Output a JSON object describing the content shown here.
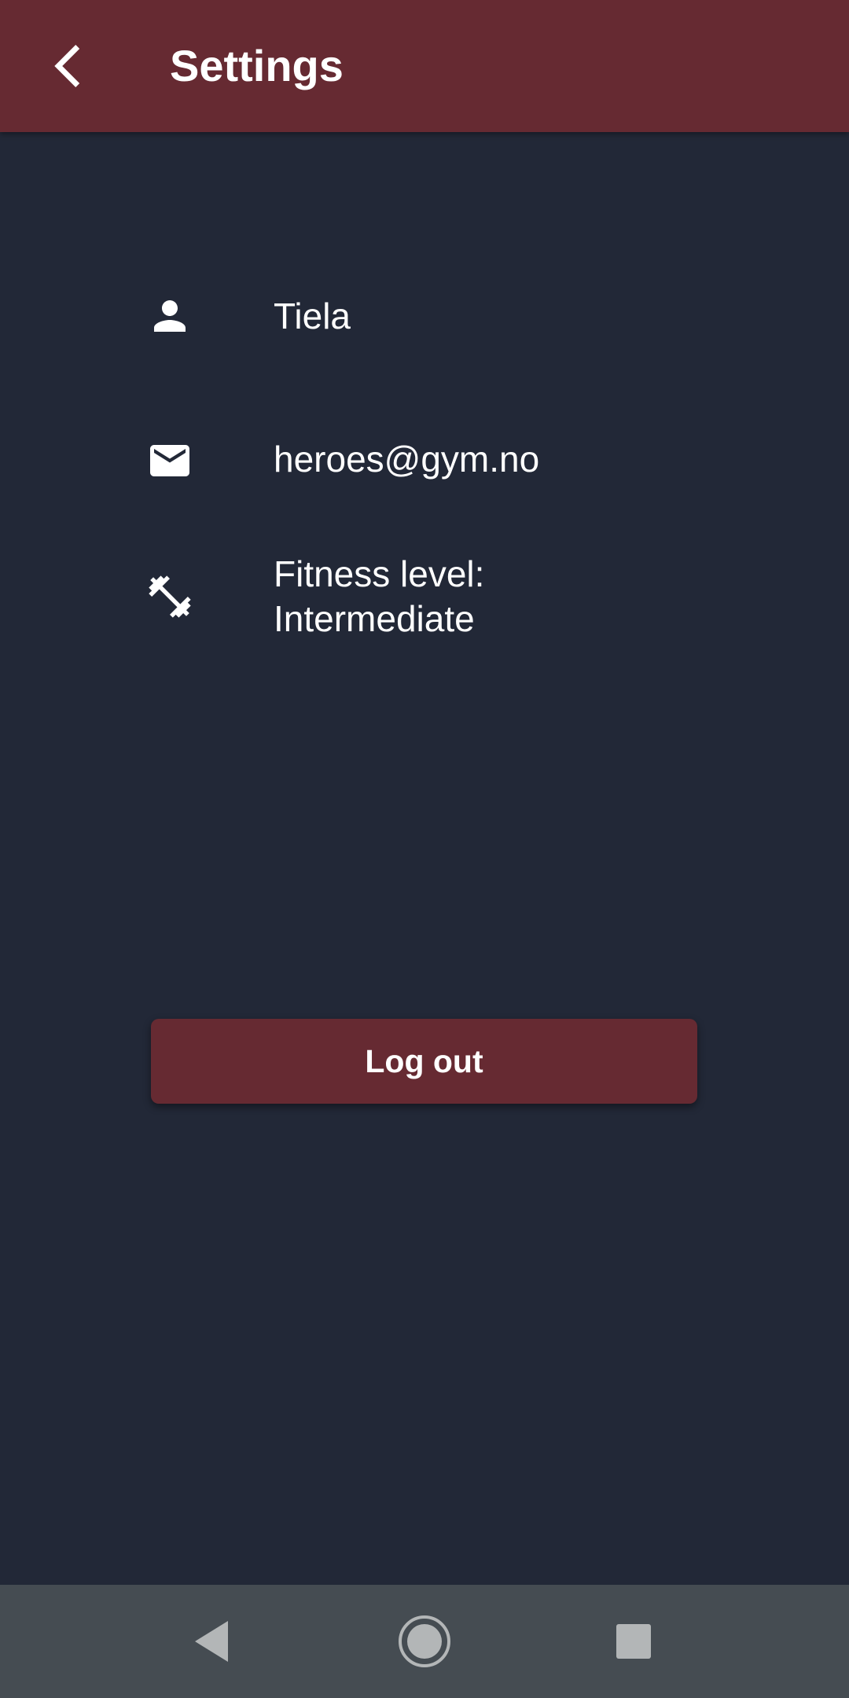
{
  "app_bar": {
    "title": "Settings",
    "back_icon": "chevron-left-icon",
    "background": "#662a32"
  },
  "profile": {
    "name": "Tiela",
    "name_icon": "person-icon",
    "email": "heroes@gym.no",
    "email_icon": "mail-icon",
    "fitness_level_label": "Fitness level:",
    "fitness_level_value": "Intermediate",
    "fitness_icon": "dumbbell-icon"
  },
  "actions": {
    "logout_label": "Log out"
  },
  "system_nav": {
    "back_icon": "triangle-back-icon",
    "home_icon": "circle-home-icon",
    "recents_icon": "square-recents-icon"
  },
  "colors": {
    "background": "#222837",
    "accent": "#662a32",
    "nav_bar": "#454c52",
    "text": "#ffffff"
  }
}
